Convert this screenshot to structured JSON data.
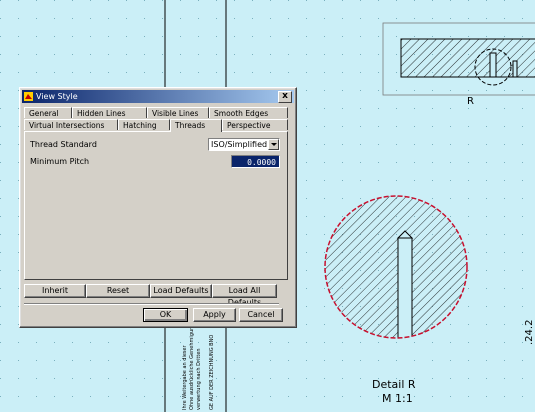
{
  "dialog": {
    "title": "View Style",
    "close_label": "x",
    "tabs_row1": [
      "General",
      "Hidden Lines",
      "Visible Lines",
      "Smooth Edges"
    ],
    "tabs_row2": [
      "Virtual Intersections",
      "Hatching",
      "Threads",
      "Perspective"
    ],
    "active_tab": "Threads",
    "thread_standard_label": "Thread Standard",
    "thread_standard_value": "ISO/Simplified",
    "minimum_pitch_label": "Minimum Pitch",
    "minimum_pitch_value": "0.0000",
    "buttons": {
      "inherit": "Inherit",
      "reset": "Reset",
      "load_defaults": "Load Defaults",
      "load_all_defaults": "Load All Defaults",
      "ok": "OK",
      "apply": "Apply",
      "cancel": "Cancel"
    }
  },
  "drawing": {
    "section_label": "R",
    "detail_title": "Detail R",
    "detail_scale": "M 1:1",
    "right_edge_text": ".24.2",
    "vertical_note_1": "Ihre Weitergabe an dieser",
    "vertical_note_2": "Ohne ausdrückliche Genehmigung",
    "vertical_note_3": "verwertung nach Dritten",
    "vertical_note_4": "GE AUF DER ZEICHNUNG BNO",
    "colors": {
      "background": "#cbeff7",
      "hatch": "#000000",
      "detail_circle": "#c8102e"
    }
  }
}
